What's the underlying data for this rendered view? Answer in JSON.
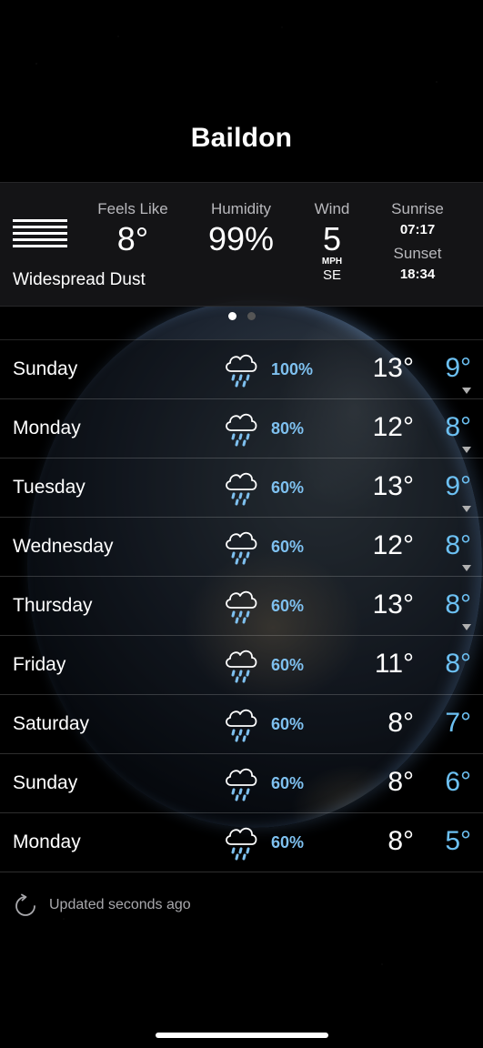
{
  "city": "Baildon",
  "current": {
    "icon": "dust-haze-icon",
    "condition": "Widespread Dust",
    "feels_like_label": "Feels Like",
    "feels_like": "8°",
    "humidity_label": "Humidity",
    "humidity": "99%",
    "wind_label": "Wind",
    "wind_speed": "5",
    "wind_unit": "MPH",
    "wind_dir": "SE",
    "sunrise_label": "Sunrise",
    "sunrise": "07:17",
    "sunset_label": "Sunset",
    "sunset": "18:34"
  },
  "pager": {
    "pages": 2,
    "active": 0
  },
  "forecast": [
    {
      "day": "Sunday",
      "precip": "100%",
      "high": "13°",
      "low": "9°",
      "icon": "rain-cloud-icon",
      "expandable": true
    },
    {
      "day": "Monday",
      "precip": "80%",
      "high": "12°",
      "low": "8°",
      "icon": "rain-cloud-icon",
      "expandable": true
    },
    {
      "day": "Tuesday",
      "precip": "60%",
      "high": "13°",
      "low": "9°",
      "icon": "rain-cloud-icon",
      "expandable": true
    },
    {
      "day": "Wednesday",
      "precip": "60%",
      "high": "12°",
      "low": "8°",
      "icon": "rain-cloud-icon",
      "expandable": true
    },
    {
      "day": "Thursday",
      "precip": "60%",
      "high": "13°",
      "low": "8°",
      "icon": "rain-cloud-icon",
      "expandable": true
    },
    {
      "day": "Friday",
      "precip": "60%",
      "high": "11°",
      "low": "8°",
      "icon": "rain-cloud-icon",
      "expandable": false
    },
    {
      "day": "Saturday",
      "precip": "60%",
      "high": "8°",
      "low": "7°",
      "icon": "rain-cloud-icon",
      "expandable": false
    },
    {
      "day": "Sunday",
      "precip": "60%",
      "high": "8°",
      "low": "6°",
      "icon": "rain-cloud-icon",
      "expandable": false
    },
    {
      "day": "Monday",
      "precip": "60%",
      "high": "8°",
      "low": "5°",
      "icon": "rain-cloud-icon",
      "expandable": false
    }
  ],
  "updated": {
    "icon": "refresh-icon",
    "text": "Updated seconds ago"
  },
  "colors": {
    "background": "#000000",
    "panel": "#161618",
    "precip_blue": "#7ec0ef",
    "low_temp_blue": "#6cc0f2",
    "label_gray": "#b8b8bc",
    "dot_active": "#ffffff",
    "dot_inactive": "#555555"
  }
}
